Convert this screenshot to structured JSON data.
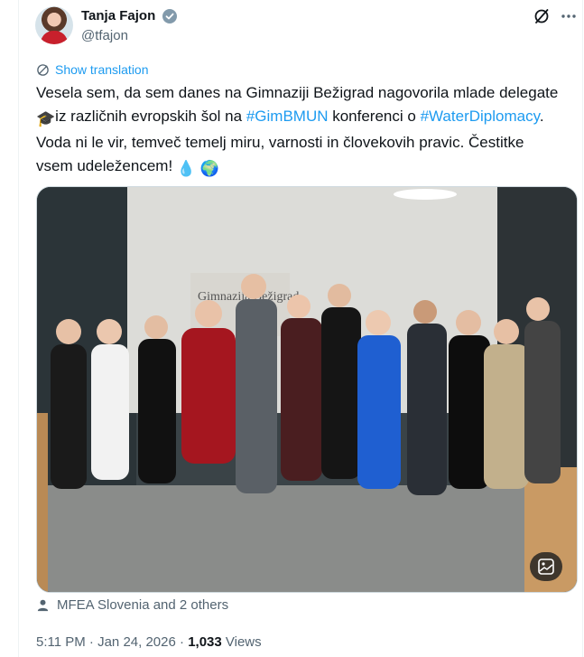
{
  "author": {
    "name": "Tanja Fajon",
    "handle": "@tfajon"
  },
  "translate": {
    "label": "Show translation"
  },
  "tweet": {
    "seg1": "Vesela sem, da sem danes na Gimnaziji Bežigrad nagovorila mlade delegate ",
    "emoji_grad": "🎓",
    "seg2": "iz različnih evropskih šol na ",
    "hashtag1": "#GimBMUN",
    "seg3": " konferenci o ",
    "hashtag2": "#WaterDiplomacy",
    "seg4": ". Voda ni le vir, temveč temelj miru, varnosti in človekovih pravic. Čestitke vsem udeležencem! ",
    "emoji_drop": "💧",
    "emoji_globe": "🌍"
  },
  "photo": {
    "sign_text": "Gimnazija Bežigrad"
  },
  "engagement": {
    "liked_by": "MFEA Slovenia and 2 others"
  },
  "meta": {
    "time": "5:11 PM",
    "sep1": " · ",
    "date": "Jan 24, 2026",
    "sep2": " · ",
    "views_count": "1,033",
    "views_label": " Views"
  },
  "icons": {
    "verified": "verified-badge-icon",
    "grok": "grok-icon",
    "more": "more-icon",
    "translate": "globe-icon",
    "person": "person-icon",
    "alt": "alt-text-icon"
  },
  "colors": {
    "link": "#1d9bf0",
    "secondary_text": "#536471",
    "primary_text": "#0f1419"
  }
}
